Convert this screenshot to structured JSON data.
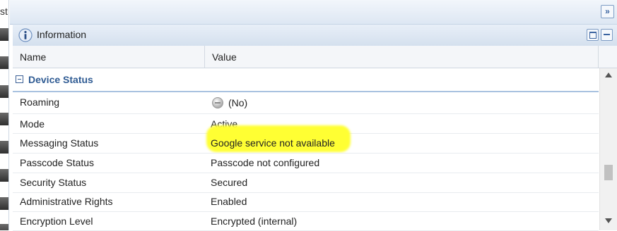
{
  "left_strip": {
    "cut_text": "st"
  },
  "top_bar": {
    "expand_label": "»"
  },
  "panel": {
    "title": "Information",
    "icon": "info-icon"
  },
  "columns": {
    "name": "Name",
    "value": "Value"
  },
  "group": {
    "title": "Device Status"
  },
  "rows": [
    {
      "name": "Roaming",
      "value": "(No)",
      "icon": "status-dot-icon"
    },
    {
      "name": "Mode",
      "value": "Active"
    },
    {
      "name": "Messaging Status",
      "value": "Google service not available",
      "highlight_color": "#ffff33"
    },
    {
      "name": "Passcode Status",
      "value": "Passcode not configured"
    },
    {
      "name": "Security Status",
      "value": "Secured"
    },
    {
      "name": "Administrative Rights",
      "value": "Enabled"
    },
    {
      "name": "Encryption Level",
      "value": "Encrypted (internal)"
    }
  ],
  "colors": {
    "accent": "#2f5b93",
    "header_bg": "#dde7f3"
  }
}
